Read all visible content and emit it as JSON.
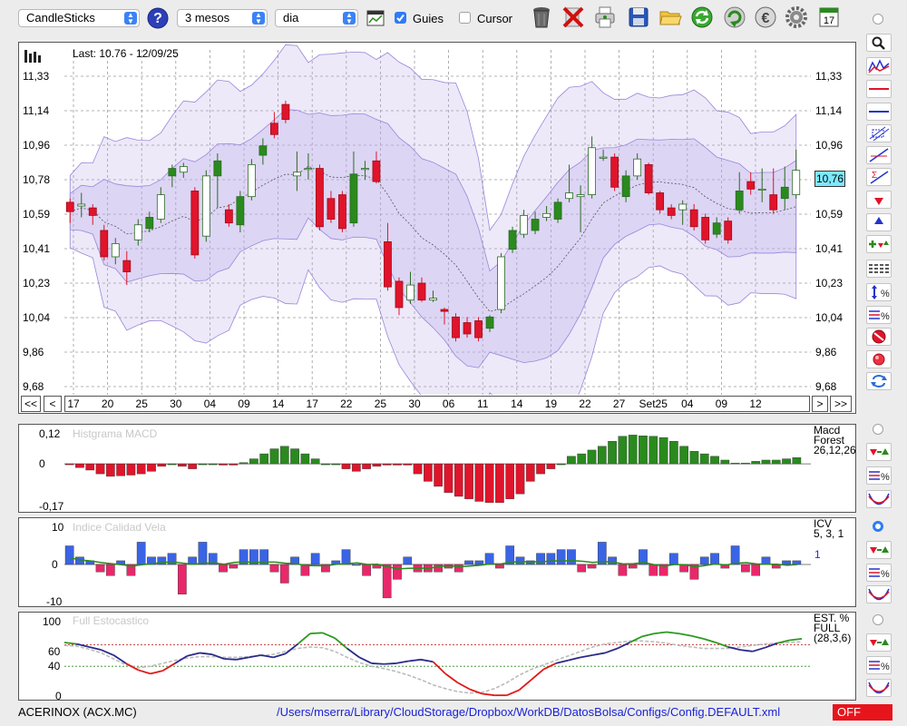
{
  "toolbar": {
    "chart_type": "CandleSticks",
    "help_icon": "question-icon",
    "period": "3 mesos",
    "interval": "dia",
    "guides_label": "Guies",
    "guides_checked": true,
    "cursor_label": "Cursor",
    "cursor_checked": false,
    "icons": [
      "table-icon",
      "trash-icon",
      "delete-icon",
      "print-icon",
      "save-icon",
      "folder-icon",
      "refresh-icon",
      "download-icon",
      "euro-icon",
      "gear-icon",
      "calendar-icon"
    ],
    "calendar_day": "17"
  },
  "main_chart": {
    "last_label": "Last: 10.76 - 12/09/25",
    "price_tag": "10,76",
    "y_ticks": [
      "11,33",
      "11,14",
      "10,96",
      "10,78",
      "10,59",
      "10,41",
      "10,23",
      "10,04",
      "9,86",
      "9,68"
    ],
    "x_ticks": [
      "17",
      "20",
      "25",
      "30",
      "04",
      "09",
      "14",
      "17",
      "22",
      "25",
      "30",
      "06",
      "11",
      "14",
      "19",
      "22",
      "27",
      "Set25",
      "04",
      "09",
      "12"
    ],
    "nav": {
      "first": "<<",
      "prev": "<",
      "next": ">",
      "last": ">>"
    }
  },
  "macd": {
    "title": "Histgrama MACD",
    "legend": [
      "Macd",
      "Forest",
      "26,12,26"
    ],
    "y_ticks": [
      "0,12",
      "0",
      "-0,17"
    ]
  },
  "icv": {
    "title": "Indice Calidad Vela",
    "legend": [
      "ICV",
      "5, 3, 1"
    ],
    "value": "1",
    "y_ticks": [
      "10",
      "0",
      "-10"
    ]
  },
  "stoch": {
    "title": "Full Estocastico",
    "legend": [
      "EST. %",
      "FULL",
      "(28,3,6)"
    ],
    "y_ticks": [
      "100",
      "60",
      "40",
      "0"
    ]
  },
  "status": {
    "ticker": "ACERINOX (ACX.MC)",
    "path": "/Users/mserra/Library/CloudStorage/Dropbox/WorkDB/DatosBolsa/Configs/Config.DEFAULT.xml",
    "off_label": "OFF"
  },
  "colors": {
    "up": "#2a8a1e",
    "down": "#e0142a",
    "band": "#b9a8e8",
    "macd_pos": "#2a8a1e",
    "macd_neg": "#e0142a",
    "icv_pos": "#3a64e6",
    "icv_neg": "#e8286a",
    "tag_bg": "#7de8ff",
    "off_bg": "#e8141c"
  },
  "chart_data": [
    {
      "type": "candlestick",
      "title": "Last: 10.76 - 12/09/25",
      "ylim": [
        9.68,
        11.33
      ],
      "x_ticks": [
        "17",
        "20",
        "25",
        "30",
        "04",
        "09",
        "14",
        "17",
        "22",
        "25",
        "30",
        "06",
        "11",
        "14",
        "19",
        "22",
        "27",
        "Set25",
        "04",
        "09",
        "12"
      ],
      "candles": [
        {
          "o": 10.66,
          "c": 10.61,
          "h": 10.68,
          "l": 10.55
        },
        {
          "o": 10.64,
          "c": 10.65,
          "h": 10.71,
          "l": 10.58
        },
        {
          "o": 10.63,
          "c": 10.59,
          "h": 10.65,
          "l": 10.54
        },
        {
          "o": 10.51,
          "c": 10.37,
          "h": 10.54,
          "l": 10.35
        },
        {
          "o": 10.37,
          "c": 10.44,
          "h": 10.47,
          "l": 10.33
        },
        {
          "o": 10.35,
          "c": 10.29,
          "h": 10.4,
          "l": 10.22
        },
        {
          "o": 10.46,
          "c": 10.54,
          "h": 10.57,
          "l": 10.43
        },
        {
          "o": 10.52,
          "c": 10.58,
          "h": 10.61,
          "l": 10.5
        },
        {
          "o": 10.57,
          "c": 10.7,
          "h": 10.74,
          "l": 10.55
        },
        {
          "o": 10.8,
          "c": 10.84,
          "h": 10.86,
          "l": 10.74
        },
        {
          "o": 10.82,
          "c": 10.85,
          "h": 10.87,
          "l": 10.79
        },
        {
          "o": 10.72,
          "c": 10.38,
          "h": 10.74,
          "l": 10.36
        },
        {
          "o": 10.48,
          "c": 10.8,
          "h": 10.83,
          "l": 10.45
        },
        {
          "o": 10.8,
          "c": 10.88,
          "h": 10.92,
          "l": 10.63
        },
        {
          "o": 10.62,
          "c": 10.55,
          "h": 10.65,
          "l": 10.53
        },
        {
          "o": 10.54,
          "c": 10.69,
          "h": 10.72,
          "l": 10.5
        },
        {
          "o": 10.69,
          "c": 10.86,
          "h": 10.89,
          "l": 10.67
        },
        {
          "o": 10.91,
          "c": 10.96,
          "h": 11.0,
          "l": 10.86
        },
        {
          "o": 11.08,
          "c": 11.02,
          "h": 11.14,
          "l": 11.0
        },
        {
          "o": 11.18,
          "c": 11.1,
          "h": 11.2,
          "l": 11.08
        },
        {
          "o": 10.8,
          "c": 10.82,
          "h": 10.93,
          "l": 10.72
        },
        {
          "o": 10.84,
          "c": 10.84,
          "h": 10.92,
          "l": 10.78
        },
        {
          "o": 10.84,
          "c": 10.53,
          "h": 10.86,
          "l": 10.51
        },
        {
          "o": 10.68,
          "c": 10.57,
          "h": 10.72,
          "l": 10.55
        },
        {
          "o": 10.7,
          "c": 10.52,
          "h": 10.72,
          "l": 10.5
        },
        {
          "o": 10.55,
          "c": 10.81,
          "h": 10.93,
          "l": 10.53
        },
        {
          "o": 10.84,
          "c": 10.84,
          "h": 10.88,
          "l": 10.78
        },
        {
          "o": 10.88,
          "c": 10.77,
          "h": 10.93,
          "l": 10.76
        },
        {
          "o": 10.45,
          "c": 10.21,
          "h": 10.55,
          "l": 10.19
        },
        {
          "o": 10.24,
          "c": 10.1,
          "h": 10.26,
          "l": 10.06
        },
        {
          "o": 10.14,
          "c": 10.22,
          "h": 10.29,
          "l": 10.12
        },
        {
          "o": 10.23,
          "c": 10.14,
          "h": 10.26,
          "l": 10.13
        },
        {
          "o": 10.14,
          "c": 10.15,
          "h": 10.19,
          "l": 10.13
        },
        {
          "o": 10.09,
          "c": 10.08,
          "h": 10.1,
          "l": 10.01
        },
        {
          "o": 10.05,
          "c": 9.94,
          "h": 10.07,
          "l": 9.92
        },
        {
          "o": 10.02,
          "c": 9.96,
          "h": 10.05,
          "l": 9.94
        },
        {
          "o": 10.03,
          "c": 9.94,
          "h": 10.05,
          "l": 9.92
        },
        {
          "o": 9.99,
          "c": 10.05,
          "h": 10.06,
          "l": 9.97
        },
        {
          "o": 10.09,
          "c": 10.37,
          "h": 10.39,
          "l": 10.07
        },
        {
          "o": 10.41,
          "c": 10.51,
          "h": 10.53,
          "l": 10.39
        },
        {
          "o": 10.49,
          "c": 10.59,
          "h": 10.62,
          "l": 10.47
        },
        {
          "o": 10.51,
          "c": 10.57,
          "h": 10.61,
          "l": 10.49
        },
        {
          "o": 10.58,
          "c": 10.6,
          "h": 10.64,
          "l": 10.56
        },
        {
          "o": 10.57,
          "c": 10.66,
          "h": 10.68,
          "l": 10.55
        },
        {
          "o": 10.68,
          "c": 10.71,
          "h": 10.86,
          "l": 10.66
        },
        {
          "o": 10.69,
          "c": 10.7,
          "h": 10.75,
          "l": 10.5
        },
        {
          "o": 10.7,
          "c": 10.95,
          "h": 11.01,
          "l": 10.68
        },
        {
          "o": 10.9,
          "c": 10.9,
          "h": 10.94,
          "l": 10.88
        },
        {
          "o": 10.9,
          "c": 10.74,
          "h": 10.92,
          "l": 10.72
        },
        {
          "o": 10.69,
          "c": 10.8,
          "h": 10.83,
          "l": 10.66
        },
        {
          "o": 10.8,
          "c": 10.89,
          "h": 10.92,
          "l": 10.78
        },
        {
          "o": 10.86,
          "c": 10.71,
          "h": 10.87,
          "l": 10.7
        },
        {
          "o": 10.71,
          "c": 10.62,
          "h": 10.72,
          "l": 10.6
        },
        {
          "o": 10.63,
          "c": 10.59,
          "h": 10.65,
          "l": 10.57
        },
        {
          "o": 10.62,
          "c": 10.65,
          "h": 10.67,
          "l": 10.54
        },
        {
          "o": 10.62,
          "c": 10.53,
          "h": 10.65,
          "l": 10.51
        },
        {
          "o": 10.58,
          "c": 10.46,
          "h": 10.6,
          "l": 10.44
        },
        {
          "o": 10.49,
          "c": 10.55,
          "h": 10.58,
          "l": 10.47
        },
        {
          "o": 10.56,
          "c": 10.46,
          "h": 10.58,
          "l": 10.44
        },
        {
          "o": 10.62,
          "c": 10.72,
          "h": 10.82,
          "l": 10.6
        },
        {
          "o": 10.77,
          "c": 10.73,
          "h": 10.82,
          "l": 10.7
        },
        {
          "o": 10.73,
          "c": 10.73,
          "h": 10.84,
          "l": 10.66
        },
        {
          "o": 10.7,
          "c": 10.62,
          "h": 10.84,
          "l": 10.6
        },
        {
          "o": 10.68,
          "c": 10.74,
          "h": 10.85,
          "l": 10.62
        },
        {
          "o": 10.7,
          "c": 10.83,
          "h": 10.94,
          "l": 10.68
        }
      ]
    },
    {
      "type": "bar",
      "title": "Histgrama MACD",
      "ylim": [
        -0.17,
        0.12
      ],
      "values": [
        -0.002,
        -0.015,
        -0.025,
        -0.04,
        -0.05,
        -0.048,
        -0.045,
        -0.04,
        -0.03,
        -0.01,
        0,
        -0.01,
        -0.02,
        0,
        0,
        -0.005,
        -0.005,
        0.005,
        0.02,
        0.04,
        0.06,
        0.07,
        0.06,
        0.04,
        0.02,
        0,
        0,
        -0.02,
        -0.03,
        -0.02,
        -0.01,
        -0.005,
        -0.005,
        -0.005,
        -0.04,
        -0.07,
        -0.09,
        -0.115,
        -0.13,
        -0.14,
        -0.15,
        -0.155,
        -0.155,
        -0.14,
        -0.12,
        -0.07,
        -0.04,
        -0.02,
        0,
        0.03,
        0.04,
        0.055,
        0.07,
        0.09,
        0.11,
        0.115,
        0.112,
        0.11,
        0.105,
        0.09,
        0.07,
        0.05,
        0.04,
        0.03,
        0.015,
        0.003,
        0.003,
        0.01,
        0.015,
        0.015,
        0.02,
        0.025
      ]
    },
    {
      "type": "bar",
      "title": "Indice Calidad Vela",
      "ylim": [
        -10,
        10
      ],
      "values": [
        5,
        2,
        1,
        -2,
        -3,
        1,
        -3,
        6,
        2,
        2,
        3,
        -8,
        2,
        6,
        3,
        -2,
        -1,
        4,
        4,
        4,
        -2,
        -5,
        2,
        -3,
        3,
        -2,
        1,
        4,
        0,
        -3,
        -1,
        -9,
        -4,
        2,
        -2,
        -2,
        -2,
        -1,
        -2,
        1,
        1,
        3,
        -1,
        5,
        2,
        1,
        3,
        3,
        4,
        4,
        -2,
        -1,
        6,
        2,
        -3,
        -1,
        4,
        -3,
        -3,
        3,
        -2,
        -4,
        2,
        3,
        -1,
        5,
        -2,
        -3,
        2,
        -1,
        1,
        1
      ]
    },
    {
      "type": "line",
      "title": "Full Estocastico",
      "ylim": [
        0,
        100
      ],
      "series": [
        {
          "values": [
            72,
            70,
            66,
            62,
            55,
            44,
            35,
            30,
            34,
            44,
            54,
            58,
            56,
            50,
            49,
            52,
            55,
            52,
            57,
            70,
            84,
            85,
            78,
            64,
            52,
            44,
            43,
            44,
            47,
            49,
            46,
            30,
            18,
            9,
            3,
            1,
            1,
            8,
            22,
            36,
            44,
            48,
            52,
            55,
            58,
            64,
            72,
            80,
            84,
            86,
            84,
            81,
            77,
            72,
            66,
            62,
            60,
            65,
            71,
            75,
            77
          ]
        },
        {
          "values": [
            68,
            67,
            63,
            58,
            50,
            42,
            38,
            40,
            44,
            48,
            51,
            53,
            53,
            52,
            52,
            53,
            54,
            56,
            60,
            64,
            66,
            65,
            60,
            52,
            45,
            40,
            37,
            33,
            28,
            22,
            15,
            10,
            6,
            4,
            5,
            10,
            18,
            28,
            36,
            42,
            48,
            54,
            60,
            66,
            70,
            72,
            74,
            74,
            73,
            71,
            68,
            66,
            64,
            64,
            64,
            66,
            68,
            70,
            71,
            72,
            73
          ]
        }
      ]
    }
  ]
}
